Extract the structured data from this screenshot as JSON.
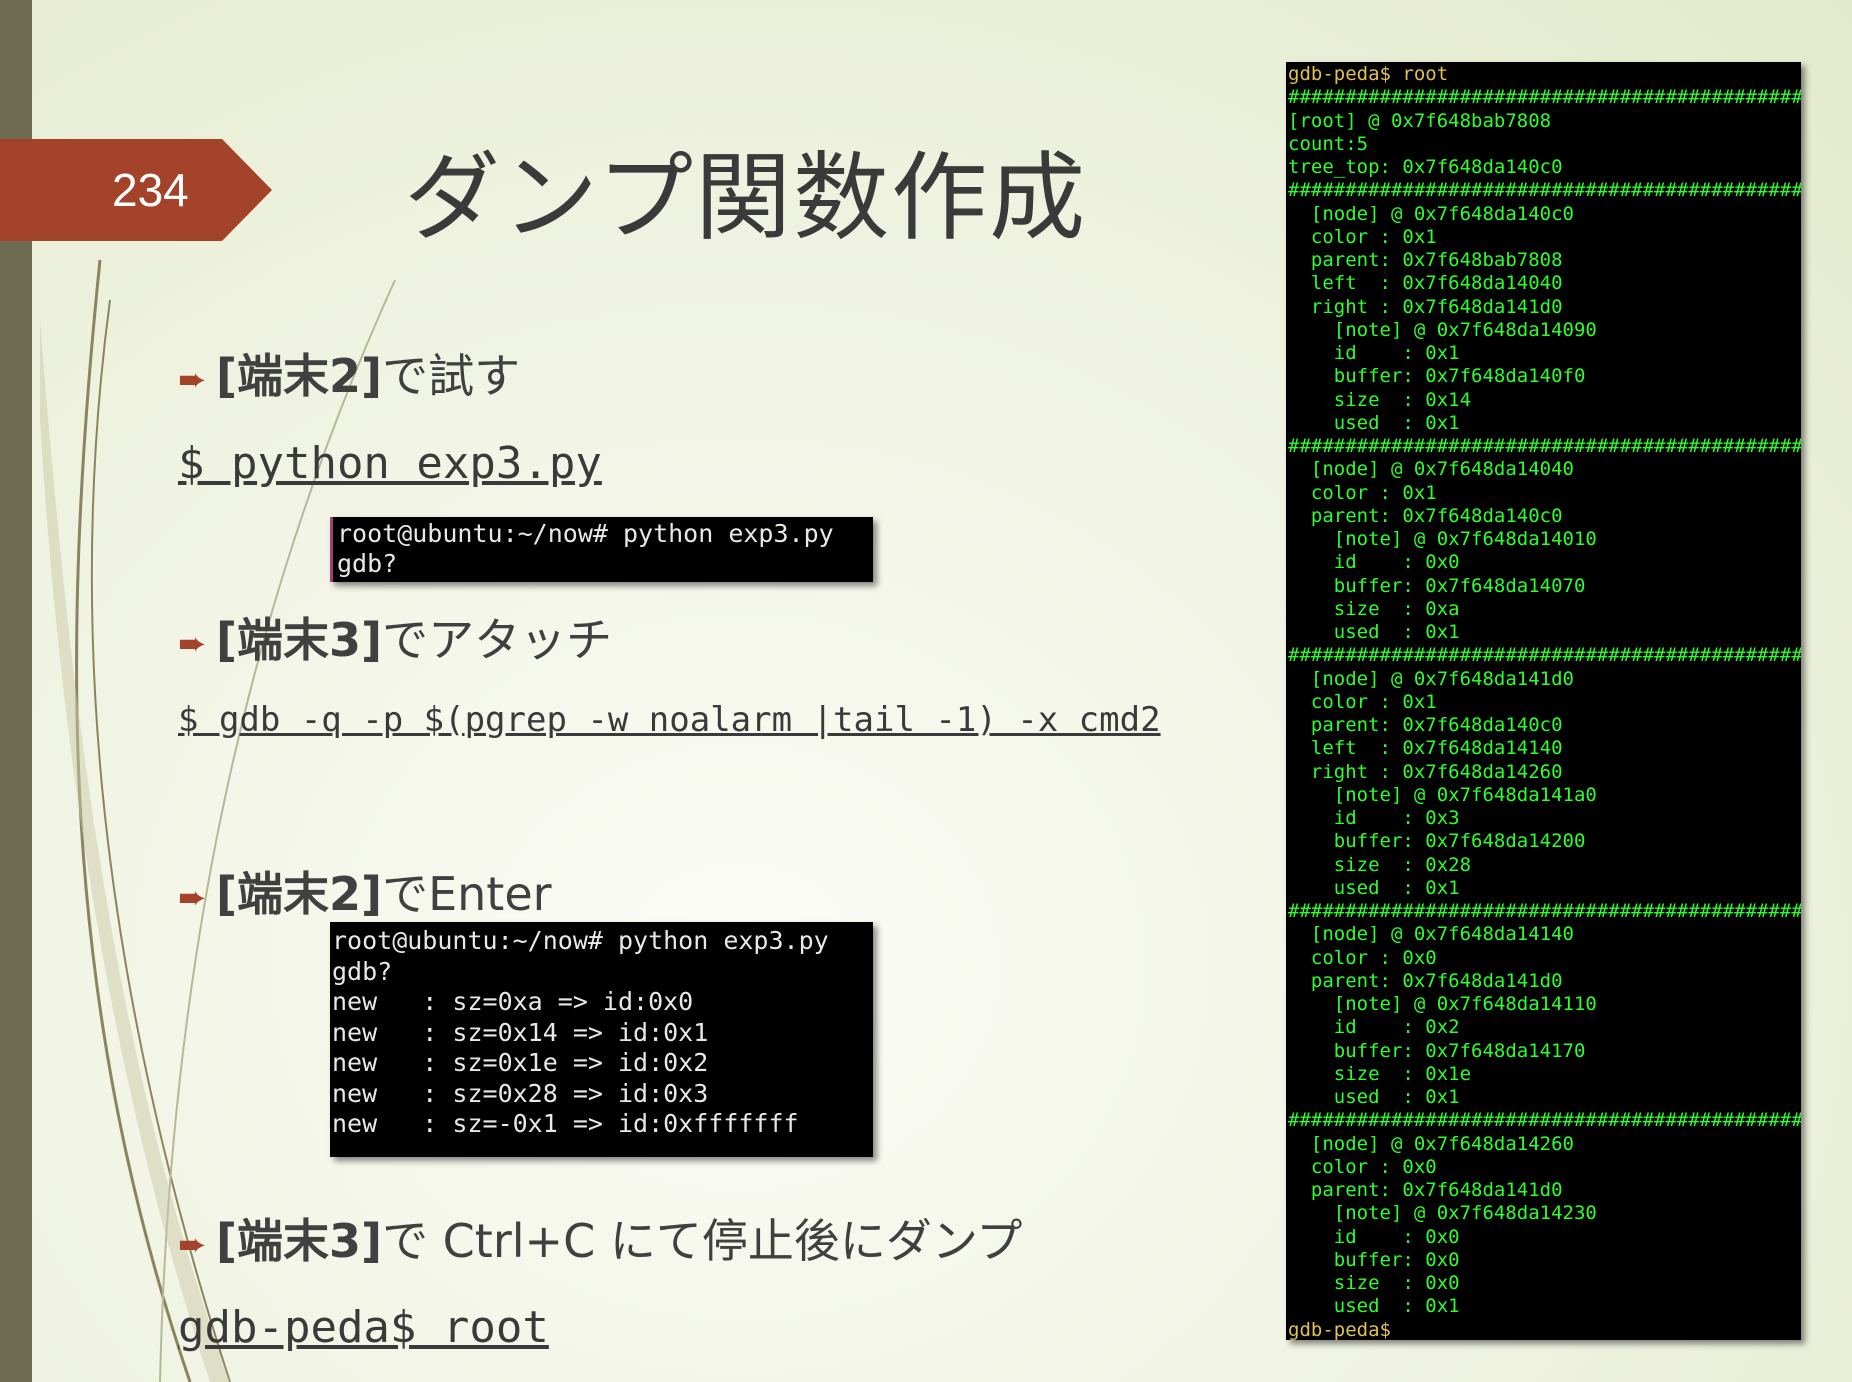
{
  "slide": {
    "number": "234",
    "title": "ダンプ関数作成"
  },
  "bullets": [
    {
      "bold": "[端末2]",
      "text": "で試す"
    },
    {
      "bold": "[端末3]",
      "text": "でアタッチ"
    },
    {
      "bold": "[端末2]",
      "text": "でEnter"
    },
    {
      "bold": "[端末3]",
      "text": "で Ctrl+C にて停止後にダンプ"
    }
  ],
  "commands": [
    "$ python exp3.py",
    "$ gdb -q -p $(pgrep -w noalarm |tail -1) -x cmd2",
    "gdb-peda$ root"
  ],
  "terminal_small": "root@ubuntu:~/now# python exp3.py\ngdb?",
  "terminal_enter": "root@ubuntu:~/now# python exp3.py\ngdb?\nnew   : sz=0xa => id:0x0\nnew   : sz=0x14 => id:0x1\nnew   : sz=0x1e => id:0x2\nnew   : sz=0x28 => id:0x3\nnew   : sz=-0x1 => id:0xfffffff",
  "terminal_dump": {
    "prompt_top": "gdb-peda$ root",
    "body": "##############################################\n[root] @ 0x7f648bab7808\ncount:5\ntree_top: 0x7f648da140c0\n##############################################\n  [node] @ 0x7f648da140c0\n  color : 0x1\n  parent: 0x7f648bab7808\n  left  : 0x7f648da14040\n  right : 0x7f648da141d0\n    [note] @ 0x7f648da14090\n    id    : 0x1\n    buffer: 0x7f648da140f0\n    size  : 0x14\n    used  : 0x1\n##############################################\n  [node] @ 0x7f648da14040\n  color : 0x1\n  parent: 0x7f648da140c0\n    [note] @ 0x7f648da14010\n    id    : 0x0\n    buffer: 0x7f648da14070\n    size  : 0xa\n    used  : 0x1\n##############################################\n  [node] @ 0x7f648da141d0\n  color : 0x1\n  parent: 0x7f648da140c0\n  left  : 0x7f648da14140\n  right : 0x7f648da14260\n    [note] @ 0x7f648da141a0\n    id    : 0x3\n    buffer: 0x7f648da14200\n    size  : 0x28\n    used  : 0x1\n##############################################\n  [node] @ 0x7f648da14140\n  color : 0x0\n  parent: 0x7f648da141d0\n    [note] @ 0x7f648da14110\n    id    : 0x2\n    buffer: 0x7f648da14170\n    size  : 0x1e\n    used  : 0x1\n##############################################\n  [node] @ 0x7f648da14260\n  color : 0x0\n  parent: 0x7f648da141d0\n    [note] @ 0x7f648da14230\n    id    : 0x0\n    buffer: 0x0\n    size  : 0x0\n    used  : 0x1",
    "prompt_bottom": "gdb-peda$"
  },
  "colors": {
    "accent": "#a3432a",
    "terminal_green": "#2bff2b",
    "prompt_yellow": "#e0c050"
  }
}
